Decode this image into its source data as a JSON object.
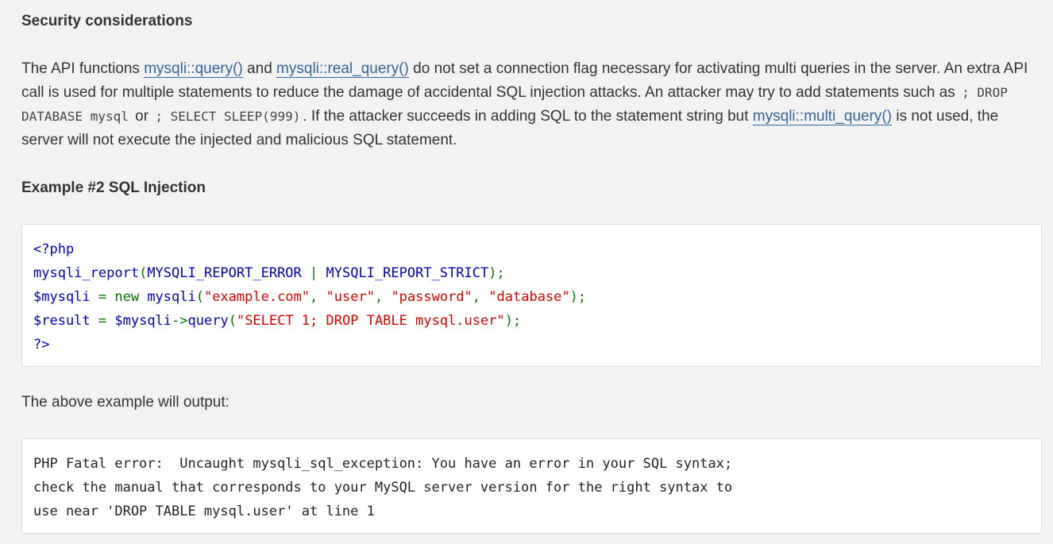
{
  "section": {
    "title": "Security considerations"
  },
  "paragraph": {
    "t1": "The API functions ",
    "link1": "mysqli::query()",
    "t2": " and ",
    "link2": "mysqli::real_query()",
    "t3": " do not set a connection flag necessary for activating multi queries in the server. An extra API call is used for multiple statements to reduce the damage of accidental SQL injection attacks. An attacker may try to add statements such as ",
    "code1": "; DROP DATABASE mysql",
    "t4": " or ",
    "code2": "; SELECT SLEEP(999)",
    "t5": ". If the attacker succeeds in adding SQL to the statement string but ",
    "link3": "mysqli::multi_query()",
    "t6": " is not used, the server will not execute the injected and malicious SQL statement."
  },
  "example": {
    "title": "Example #2 SQL Injection",
    "code": {
      "l1": "<?php",
      "l2_fn": "mysqli_report",
      "l2_open": "(",
      "l2_c1": "MYSQLI_REPORT_ERROR ",
      "l2_pipe": "| ",
      "l2_c2": "MYSQLI_REPORT_STRICT",
      "l2_close": ");",
      "l3_var": "$mysqli ",
      "l3_eq": "= new ",
      "l3_fn": "mysqli",
      "l3_open": "(",
      "l3_s1": "\"example.com\"",
      "l3_c1": ", ",
      "l3_s2": "\"user\"",
      "l3_c2": ", ",
      "l3_s3": "\"password\"",
      "l3_c3": ", ",
      "l3_s4": "\"database\"",
      "l3_close": ");",
      "l4_var": "$result ",
      "l4_eq": "= ",
      "l4_var2": "$mysqli",
      "l4_arrow": "->",
      "l4_fn": "query",
      "l4_open": "(",
      "l4_s": "\"SELECT 1; DROP TABLE mysql.user\"",
      "l4_close": ");",
      "l5": "?>"
    },
    "output_label": "The above example will output:",
    "output": {
      "l1": "PHP Fatal error:  Uncaught mysqli_sql_exception: You have an error in your SQL syntax;",
      "l2": "check the manual that corresponds to your MySQL server version for the right syntax to",
      "l3": "use near 'DROP TABLE mysql.user' at line 1"
    }
  }
}
